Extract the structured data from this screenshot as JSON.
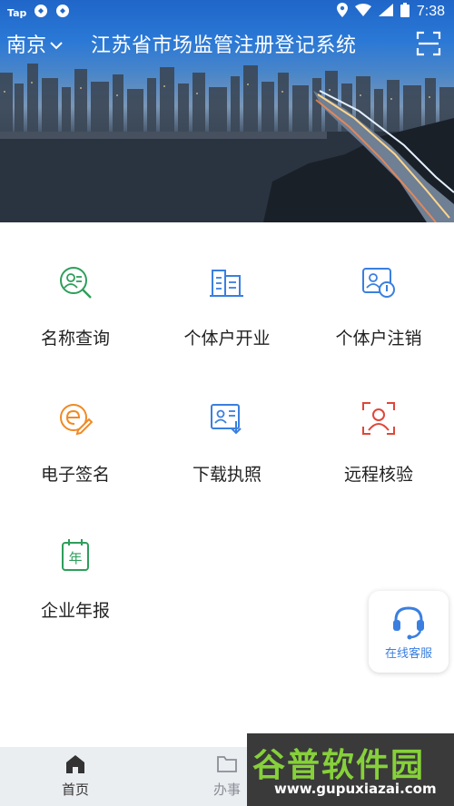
{
  "status_bar": {
    "carrier": "Tap",
    "time": "7:38"
  },
  "header": {
    "city": "南京",
    "title": "江苏省市场监管注册登记系统"
  },
  "services": [
    {
      "label": "名称查询",
      "icon": "name-search-icon",
      "color": "#2e9e5b"
    },
    {
      "label": "个体户开业",
      "icon": "building-icon",
      "color": "#3a7fe0"
    },
    {
      "label": "个体户注销",
      "icon": "user-cancel-icon",
      "color": "#3a7fe0"
    },
    {
      "label": "电子签名",
      "icon": "e-sign-icon",
      "color": "#f08a24"
    },
    {
      "label": "下载执照",
      "icon": "download-license-icon",
      "color": "#3a7fe0"
    },
    {
      "label": "远程核验",
      "icon": "face-verify-icon",
      "color": "#e0463a"
    },
    {
      "label": "企业年报",
      "icon": "annual-report-icon",
      "color": "#2e9e5b"
    }
  ],
  "report_icon_glyph": "年",
  "floating_service": {
    "label": "在线客服",
    "color": "#3a7fe0"
  },
  "bottom_nav": [
    {
      "label": "首页",
      "active": true
    },
    {
      "label": "办事",
      "active": false
    }
  ],
  "watermark": {
    "brand": "谷普软件园",
    "url": "www.gupuxiazai.com"
  }
}
